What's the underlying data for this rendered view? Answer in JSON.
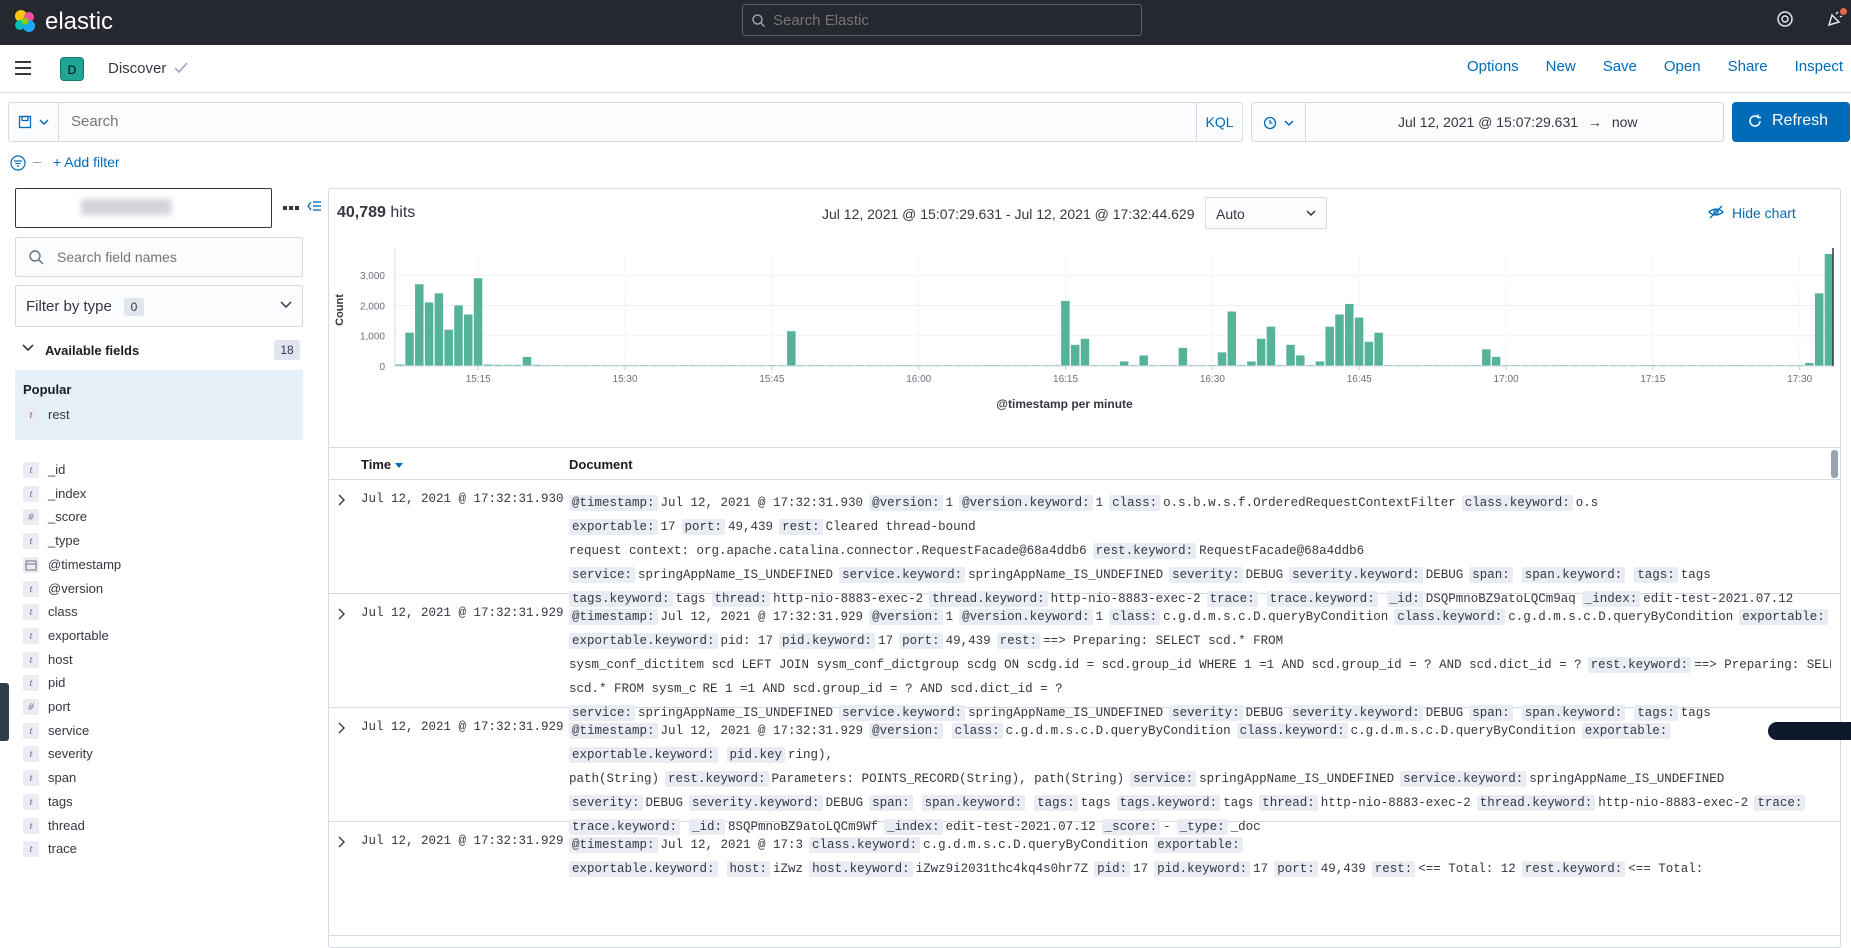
{
  "header": {
    "logo_text": "elastic",
    "search_placeholder": "Search Elastic"
  },
  "appbar": {
    "space_initial": "D",
    "title": "Discover",
    "actions": [
      "Options",
      "New",
      "Save",
      "Open",
      "Share",
      "Inspect"
    ]
  },
  "querybar": {
    "placeholder": "Search",
    "language": "KQL",
    "date_start": "Jul 12, 2021 @ 15:07:29.631",
    "date_arrow": "→",
    "date_end": "now",
    "refresh_label": "Refresh"
  },
  "filters": {
    "add_label": "+ Add filter"
  },
  "sidebar": {
    "field_search_placeholder": "Search field names",
    "filter_by_type_label": "Filter by type",
    "filter_by_type_count": "0",
    "available_fields_label": "Available fields",
    "available_fields_count": "18",
    "popular_label": "Popular",
    "popular_fields": [
      {
        "type": "t",
        "name": "rest"
      }
    ],
    "fields": [
      {
        "type": "t",
        "name": "_id"
      },
      {
        "type": "t",
        "name": "_index"
      },
      {
        "type": "#",
        "name": "_score"
      },
      {
        "type": "t",
        "name": "_type"
      },
      {
        "type": "date",
        "name": "@timestamp"
      },
      {
        "type": "t",
        "name": "@version"
      },
      {
        "type": "t",
        "name": "class"
      },
      {
        "type": "t",
        "name": "exportable"
      },
      {
        "type": "t",
        "name": "host"
      },
      {
        "type": "t",
        "name": "pid"
      },
      {
        "type": "#",
        "name": "port"
      },
      {
        "type": "t",
        "name": "service"
      },
      {
        "type": "t",
        "name": "severity"
      },
      {
        "type": "t",
        "name": "span"
      },
      {
        "type": "t",
        "name": "tags"
      },
      {
        "type": "t",
        "name": "thread"
      },
      {
        "type": "t",
        "name": "trace"
      }
    ]
  },
  "results": {
    "hits_count": "40,789",
    "hits_label": "hits",
    "range_label": "Jul 12, 2021 @ 15:07:29.631 - Jul 12, 2021 @ 17:32:44.629",
    "interval": "Auto",
    "hide_chart_label": "Hide chart",
    "columns": [
      "Time",
      "Document"
    ],
    "rows": [
      {
        "time": "Jul 12, 2021 @ 17:32:31.930",
        "lines": [
          [
            [
              "k",
              "@timestamp:"
            ],
            [
              "v",
              "Jul 12, 2021 @ 17:32:31.930"
            ],
            [
              "k",
              "@version:"
            ],
            [
              "v",
              "1"
            ],
            [
              "k",
              "@version.keyword:"
            ],
            [
              "v",
              "1"
            ],
            [
              "k",
              "class:"
            ],
            [
              "v",
              "o.s.b.w.s.f.OrderedRequestContextFilter"
            ],
            [
              "k",
              "class.keyword:"
            ],
            [
              "v",
              "o.s"
            ]
          ],
          [
            [
              "k",
              "exportable:"
            ],
            [
              "v",
              "17"
            ],
            [
              "k",
              "port:"
            ],
            [
              "v",
              "49,439"
            ],
            [
              "k",
              "rest:"
            ],
            [
              "v",
              "Cleared thread-bound"
            ]
          ],
          [
            [
              "v",
              "request context: org.apache.catalina.connector.RequestFacade@68a4ddb6"
            ],
            [
              "k",
              "rest.keyword:"
            ],
            [
              "v",
              "RequestFacade@68a4ddb6"
            ]
          ],
          [
            [
              "k",
              "service:"
            ],
            [
              "v",
              "springAppName_IS_UNDEFINED"
            ],
            [
              "k",
              "service.keyword:"
            ],
            [
              "v",
              "springAppName_IS_UNDEFINED"
            ],
            [
              "k",
              "severity:"
            ],
            [
              "v",
              "DEBUG"
            ],
            [
              "k",
              "severity.keyword:"
            ],
            [
              "v",
              "DEBUG"
            ],
            [
              "k",
              "span:"
            ],
            [
              "v",
              ""
            ],
            [
              "k",
              "span.keyword:"
            ],
            [
              "v",
              ""
            ],
            [
              "k",
              "tags:"
            ],
            [
              "v",
              "tags"
            ]
          ],
          [
            [
              "k",
              "tags.keyword:"
            ],
            [
              "v",
              "tags"
            ],
            [
              "k",
              "thread:"
            ],
            [
              "v",
              "http-nio-8883-exec-2"
            ],
            [
              "k",
              "thread.keyword:"
            ],
            [
              "v",
              "http-nio-8883-exec-2"
            ],
            [
              "k",
              "trace:"
            ],
            [
              "v",
              ""
            ],
            [
              "k",
              "trace.keyword:"
            ],
            [
              "v",
              ""
            ],
            [
              "k",
              "_id:"
            ],
            [
              "v",
              "DSQPmnoBZ9atoLQCm9aq"
            ],
            [
              "k",
              "_index:"
            ],
            [
              "v",
              "edit-test-2021.07.12"
            ]
          ]
        ]
      },
      {
        "time": "Jul 12, 2021 @ 17:32:31.929",
        "lines": [
          [
            [
              "k",
              "@timestamp:"
            ],
            [
              "v",
              "Jul 12, 2021 @ 17:32:31.929"
            ],
            [
              "k",
              "@version:"
            ],
            [
              "v",
              "1"
            ],
            [
              "k",
              "@version.keyword:"
            ],
            [
              "v",
              "1"
            ],
            [
              "k",
              "class:"
            ],
            [
              "v",
              "c.g.d.m.s.c.D.queryByCondition"
            ],
            [
              "k",
              "class.keyword:"
            ],
            [
              "v",
              "c.g.d.m.s.c.D.queryByCondition"
            ],
            [
              "k",
              "exportable:"
            ],
            [
              "v",
              ""
            ]
          ],
          [
            [
              "k",
              "exportable.keyword:"
            ],
            [
              "v",
              "pid: 17"
            ],
            [
              "k",
              "pid.keyword:"
            ],
            [
              "v",
              "17"
            ],
            [
              "k",
              "port:"
            ],
            [
              "v",
              "49,439"
            ],
            [
              "k",
              "rest:"
            ],
            [
              "v",
              "==> Preparing: SELECT scd.* FROM"
            ]
          ],
          [
            [
              "v",
              "sysm_conf_dictitem scd LEFT JOIN sysm_conf_dictgroup scdg ON scdg.id = scd.group_id WHERE 1 =1 AND scd.group_id = ? AND scd.dict_id = ?"
            ],
            [
              "k",
              "rest.keyword:"
            ],
            [
              "v",
              "==> Preparing: SELECT"
            ]
          ],
          [
            [
              "v",
              "scd.* FROM sysm_c"
            ],
            [
              "v",
              "RE 1 =1 AND scd.group_id = ? AND scd.dict_id = ?"
            ]
          ],
          [
            [
              "k",
              "service:"
            ],
            [
              "v",
              "springAppName_IS_UNDEFINED"
            ],
            [
              "k",
              "service.keyword:"
            ],
            [
              "v",
              "springAppName_IS_UNDEFINED"
            ],
            [
              "k",
              "severity:"
            ],
            [
              "v",
              "DEBUG"
            ],
            [
              "k",
              "severity.keyword:"
            ],
            [
              "v",
              "DEBUG"
            ],
            [
              "k",
              "span:"
            ],
            [
              "v",
              ""
            ],
            [
              "k",
              "span.keyword:"
            ],
            [
              "v",
              ""
            ],
            [
              "k",
              "tags:"
            ],
            [
              "v",
              "tags"
            ]
          ]
        ]
      },
      {
        "time": "Jul 12, 2021 @ 17:32:31.929",
        "lines": [
          [
            [
              "k",
              "@timestamp:"
            ],
            [
              "v",
              "Jul 12, 2021 @ 17:32:31.929"
            ],
            [
              "k",
              "@version:"
            ],
            [
              "v",
              ""
            ],
            [
              "k",
              "class:"
            ],
            [
              "v",
              "c.g.d.m.s.c.D.queryByCondition"
            ],
            [
              "k",
              "class.keyword:"
            ],
            [
              "v",
              "c.g.d.m.s.c.D.queryByCondition"
            ],
            [
              "k",
              "exportable:"
            ],
            [
              "v",
              ""
            ]
          ],
          [
            [
              "k",
              "exportable.keyword:"
            ],
            [
              "v",
              ""
            ],
            [
              "k",
              "pid.key"
            ],
            [
              "v",
              "ring),"
            ]
          ],
          [
            [
              "v",
              "path(String)"
            ],
            [
              "k",
              "rest.keyword:"
            ],
            [
              "v",
              "Parameters: POINTS_RECORD(String), path(String)"
            ],
            [
              "k",
              "service:"
            ],
            [
              "v",
              "springAppName_IS_UNDEFINED"
            ],
            [
              "k",
              "service.keyword:"
            ],
            [
              "v",
              "springAppName_IS_UNDEFINED"
            ]
          ],
          [
            [
              "k",
              "severity:"
            ],
            [
              "v",
              "DEBUG"
            ],
            [
              "k",
              "severity.keyword:"
            ],
            [
              "v",
              "DEBUG"
            ],
            [
              "k",
              "span:"
            ],
            [
              "v",
              ""
            ],
            [
              "k",
              "span.keyword:"
            ],
            [
              "v",
              ""
            ],
            [
              "k",
              "tags:"
            ],
            [
              "v",
              "tags"
            ],
            [
              "k",
              "tags.keyword:"
            ],
            [
              "v",
              "tags"
            ],
            [
              "k",
              "thread:"
            ],
            [
              "v",
              "http-nio-8883-exec-2"
            ],
            [
              "k",
              "thread.keyword:"
            ],
            [
              "v",
              "http-nio-8883-exec-2"
            ],
            [
              "k",
              "trace:"
            ],
            [
              "v",
              ""
            ]
          ],
          [
            [
              "k",
              "trace.keyword:"
            ],
            [
              "v",
              ""
            ],
            [
              "k",
              "_id:"
            ],
            [
              "v",
              "8SQPmnoBZ9atoLQCm9Wf"
            ],
            [
              "k",
              "_index:"
            ],
            [
              "v",
              "edit-test-2021.07.12"
            ],
            [
              "k",
              "_score:"
            ],
            [
              "v",
              "-"
            ],
            [
              "k",
              "_type:"
            ],
            [
              "v",
              "_doc"
            ]
          ]
        ]
      },
      {
        "time": "Jul 12, 2021 @ 17:32:31.929",
        "lines": [
          [
            [
              "k",
              "@timestamp:"
            ],
            [
              "v",
              "Jul 12, 2021 @ 17:3"
            ],
            [
              "k",
              "class.keyword:"
            ],
            [
              "v",
              "c.g.d.m.s.c.D.queryByCondition"
            ],
            [
              "k",
              "exportable:"
            ],
            [
              "v",
              ""
            ]
          ],
          [
            [
              "k",
              "exportable.keyword:"
            ],
            [
              "v",
              ""
            ],
            [
              "k",
              "host:"
            ],
            [
              "v",
              "iZwz"
            ],
            [
              "k",
              "host.keyword:"
            ],
            [
              "v",
              "iZwz9i2031thc4kq4s0hr7Z"
            ],
            [
              "k",
              "pid:"
            ],
            [
              "v",
              "17"
            ],
            [
              "k",
              "pid.keyword:"
            ],
            [
              "v",
              "17"
            ],
            [
              "k",
              "port:"
            ],
            [
              "v",
              "49,439"
            ],
            [
              "k",
              "rest:"
            ],
            [
              "v",
              "<== Total: 12"
            ],
            [
              "k",
              "rest.keyword:"
            ],
            [
              "v",
              "<== Total:"
            ]
          ]
        ]
      }
    ]
  },
  "chart_data": {
    "type": "bar",
    "xlabel": "@timestamp per minute",
    "ylabel": "Count",
    "ylim": [
      0,
      3700
    ],
    "yticks": [
      0,
      1000,
      2000,
      3000
    ],
    "ytick_labels": [
      "0",
      "1,000",
      "2,000",
      "3,000"
    ],
    "x_start_minute": "15:07",
    "xticks": [
      "15:15",
      "15:30",
      "15:45",
      "16:00",
      "16:15",
      "16:30",
      "16:45",
      "17:00",
      "17:15",
      "17:30"
    ],
    "xtick_minutes": [
      8,
      23,
      38,
      53,
      68,
      83,
      98,
      113,
      128,
      143
    ],
    "series": [
      {
        "values": [
          50,
          1100,
          2700,
          2100,
          2400,
          1200,
          2000,
          1700,
          2900,
          50,
          40,
          40,
          40,
          300,
          40,
          30,
          30,
          30,
          30,
          30,
          30,
          30,
          30,
          30,
          30,
          30,
          30,
          30,
          30,
          30,
          30,
          30,
          30,
          30,
          30,
          30,
          30,
          30,
          30,
          30,
          1150,
          30,
          30,
          30,
          30,
          30,
          30,
          30,
          30,
          30,
          30,
          30,
          30,
          30,
          30,
          30,
          30,
          30,
          30,
          30,
          30,
          30,
          30,
          30,
          30,
          30,
          30,
          30,
          2150,
          700,
          900,
          30,
          30,
          30,
          150,
          30,
          350,
          30,
          30,
          30,
          600,
          30,
          30,
          30,
          450,
          1800,
          30,
          150,
          900,
          1300,
          30,
          700,
          350,
          30,
          150,
          1300,
          1700,
          2050,
          1600,
          800,
          1100,
          30,
          30,
          30,
          30,
          30,
          30,
          30,
          30,
          30,
          30,
          550,
          300,
          30,
          30,
          30,
          30,
          30,
          30,
          30,
          30,
          30,
          30,
          30,
          30,
          30,
          30,
          30,
          30,
          30,
          30,
          30,
          30,
          30,
          30,
          30,
          30,
          30,
          30,
          30,
          30,
          30,
          30,
          30,
          100,
          2400,
          3700
        ]
      }
    ]
  },
  "colors": {
    "header_bg": "#25282f",
    "bar": "#54b399",
    "link": "#006bb8",
    "refresh_bg": "#006bb8"
  }
}
